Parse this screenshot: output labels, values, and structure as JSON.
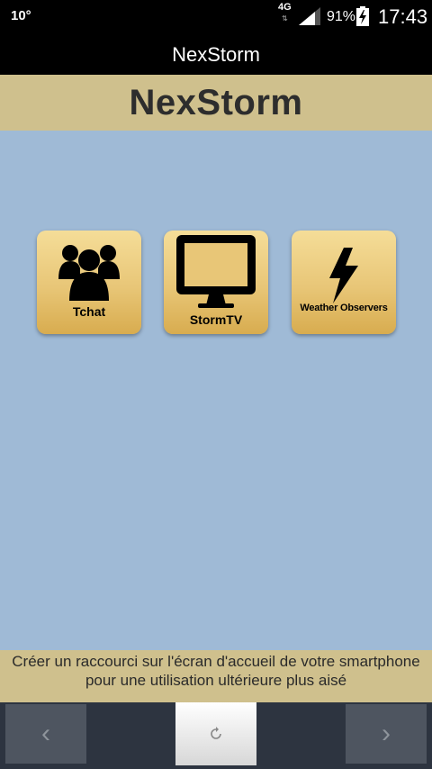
{
  "status_bar": {
    "temperature": "10°",
    "network": "4G",
    "network_arrows": "⇅",
    "battery_percent": "91%",
    "time": "17:43"
  },
  "app_bar": {
    "title": "NexStorm"
  },
  "banner": {
    "title": "NexStorm"
  },
  "tiles": [
    {
      "label": "Tchat",
      "icon": "group-icon"
    },
    {
      "label": "StormTV",
      "icon": "monitor-icon"
    },
    {
      "label": "Weather Observers",
      "icon": "lightning-icon"
    }
  ],
  "footer": {
    "text": "Créer un raccourci sur l'écran d'accueil de votre smartphone pour une utilisation ultérieure plus aisé"
  },
  "bottom_nav": {
    "back_glyph": "‹",
    "forward_glyph": "›",
    "reload_icon": "reload-icon"
  },
  "colors": {
    "banner_bg": "#cfc08d",
    "main_bg": "#9fbad6",
    "tile_gold": "#e8c677",
    "bottom_bar": "#2d3440"
  }
}
